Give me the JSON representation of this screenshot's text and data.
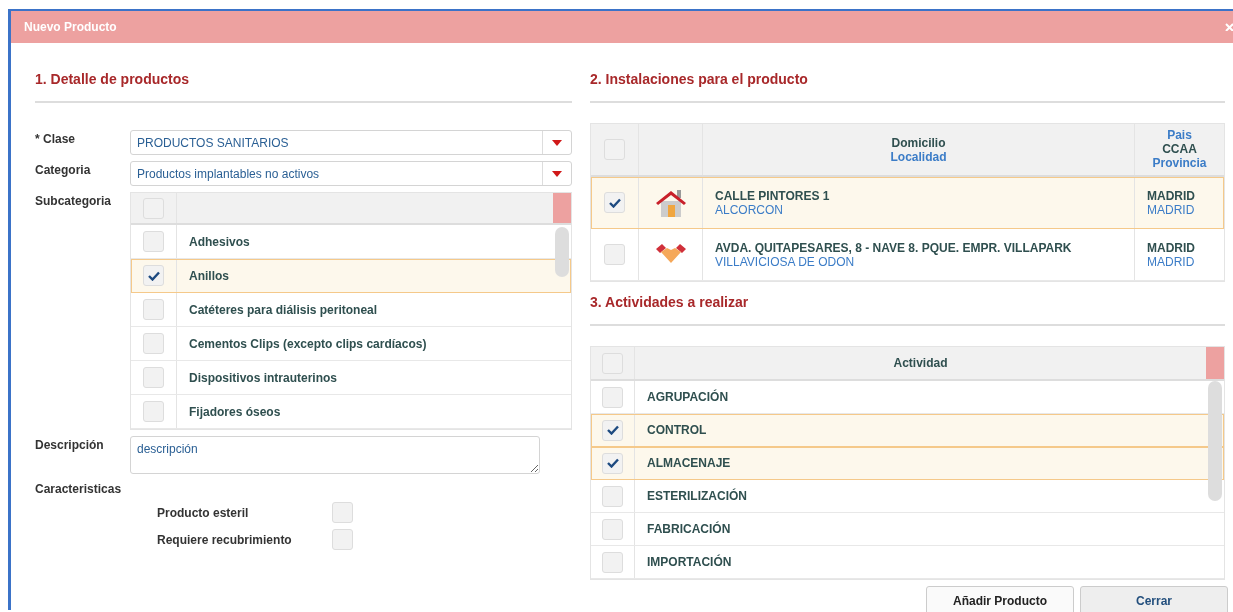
{
  "window": {
    "title": "Nuevo Producto"
  },
  "product_details": {
    "heading": "1. Detalle de productos",
    "clase": {
      "label": "* Clase",
      "value": "PRODUCTOS SANITARIOS"
    },
    "categoria": {
      "label": "Categoria",
      "value": "Productos implantables no activos"
    },
    "subcategoria": {
      "label": "Subcategoria",
      "header_checked": false,
      "items": [
        {
          "name": "Adhesivos",
          "checked": false
        },
        {
          "name": "Anillos",
          "checked": true
        },
        {
          "name": "Catéteres para diálisis peritoneal",
          "checked": false
        },
        {
          "name": "Cementos Clips (excepto clips cardíacos)",
          "checked": false
        },
        {
          "name": "Dispositivos intrauterinos",
          "checked": false
        },
        {
          "name": "Fijadores óseos",
          "checked": false
        }
      ]
    },
    "descripcion": {
      "label": "Descripción",
      "value": "descripción"
    },
    "caracteristicas": {
      "label": "Caracteristicas",
      "options": [
        {
          "label": "Producto esteril",
          "checked": false
        },
        {
          "label": "Requiere recubrimiento",
          "checked": false
        }
      ]
    }
  },
  "installations": {
    "heading": "2. Instalaciones para el producto",
    "header_checked": false,
    "columns": {
      "domicilio": "Domicilio",
      "localidad": "Localidad",
      "pais": "Pais",
      "ccaa": "CCAA",
      "provincia": "Provincia"
    },
    "rows": [
      {
        "kind": "house",
        "domicilio": "CALLE PINTORES 1",
        "localidad": "ALCORCON",
        "ccaa": "MADRID",
        "provincia": "MADRID",
        "checked": true
      },
      {
        "kind": "handshake",
        "domicilio": "AVDA. QUITAPESARES, 8 - NAVE 8. PQUE. EMPR. VILLAPARK",
        "localidad": "VILLAVICIOSA DE ODON",
        "ccaa": "MADRID",
        "provincia": "MADRID",
        "checked": false
      }
    ]
  },
  "activities": {
    "heading": "3. Actividades a realizar",
    "header_checked": false,
    "column": "Actividad",
    "rows": [
      {
        "name": "AGRUPACIÓN",
        "checked": false
      },
      {
        "name": "CONTROL",
        "checked": true
      },
      {
        "name": "ALMACENAJE",
        "checked": true
      },
      {
        "name": "ESTERILIZACIÓN",
        "checked": false
      },
      {
        "name": "FABRICACIÓN",
        "checked": false
      },
      {
        "name": "IMPORTACIÓN",
        "checked": false
      }
    ]
  },
  "buttons": [
    "Añadir Producto",
    "Cerrar"
  ]
}
